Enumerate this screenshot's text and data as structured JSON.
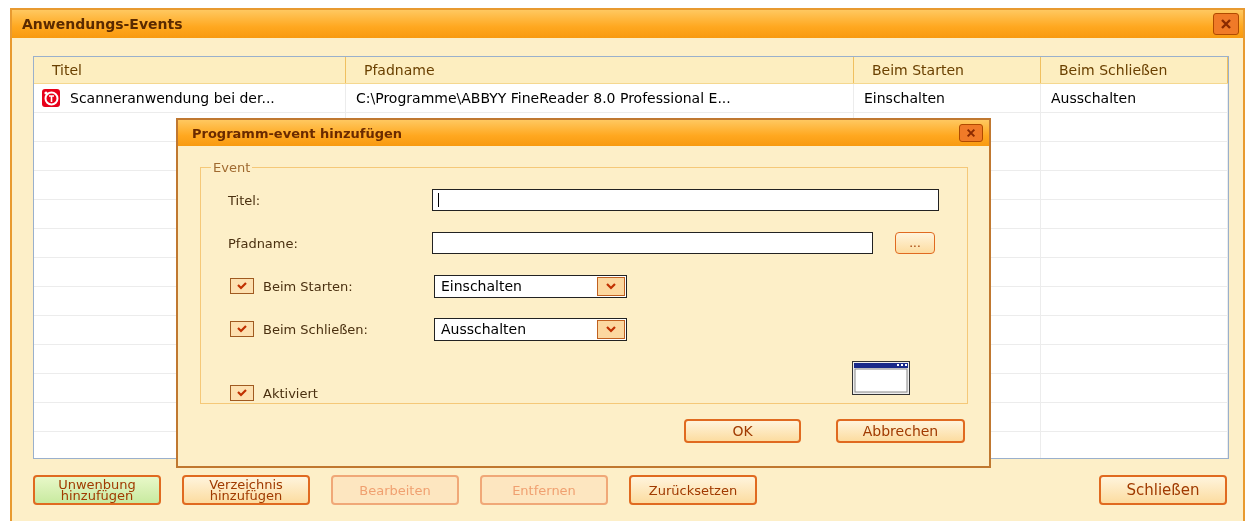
{
  "window": {
    "title": "Anwendungs-Events"
  },
  "table": {
    "columns": [
      "Titel",
      "Pfadname",
      "Beim Starten",
      "Beim Schließen"
    ],
    "rows": [
      {
        "cells": [
          "Scanneranwendung bei der...",
          "C:\\Programme\\ABBYY FineReader 8.0 Professional E...",
          "Einschalten",
          "Ausschalten"
        ]
      }
    ]
  },
  "buttons": [
    {
      "label": "Unwenbung hinzufügen",
      "disabled": false,
      "highlighted": true
    },
    {
      "label": "Verzeichnis hinzufügen",
      "disabled": false,
      "highlighted": false
    },
    {
      "label": "Bearbeiten",
      "disabled": true,
      "highlighted": false
    },
    {
      "label": "Entfernen",
      "disabled": true,
      "highlighted": false
    },
    {
      "label": "Zurücksetzen",
      "disabled": false,
      "highlighted": false
    }
  ],
  "close_button": {
    "label": "Schließen"
  },
  "dialog": {
    "title": "Programm-event hinzufügen",
    "group": "Event",
    "title_field": {
      "label": "Titel:",
      "focused": true
    },
    "path_field": {
      "label": "Pfadname:",
      "browse": "..."
    },
    "on_start": {
      "label": "Beim Starten:",
      "checked": true,
      "value": "Einschalten"
    },
    "on_close": {
      "label": "Beim Schließen:",
      "checked": true,
      "value": "Ausschalten"
    },
    "enabled": {
      "label": "Aktiviert",
      "checked": true
    },
    "buttons": [
      "OK",
      "Abbrechen"
    ]
  }
}
